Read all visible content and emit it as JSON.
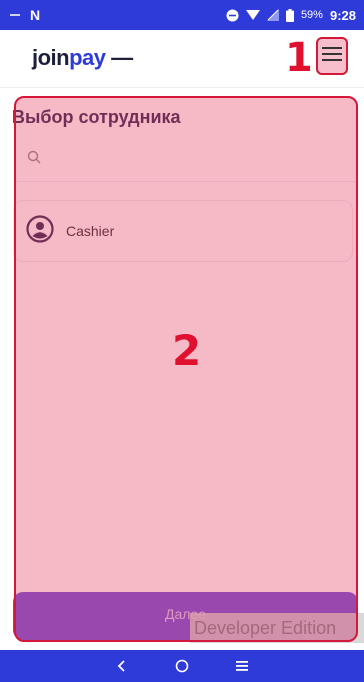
{
  "status_bar": {
    "left_letter": "N",
    "battery": "59%",
    "time": "9:28"
  },
  "header": {
    "logo_part1": "join",
    "logo_part2": "pay",
    "logo_part3": "—",
    "annotation_marker": "1"
  },
  "main": {
    "title": "Выбор сотрудника",
    "search_placeholder": "",
    "employees": [
      {
        "name": "Cashier"
      }
    ],
    "next_button_label": "Далее",
    "watermark": "Developer Edition",
    "annotation_marker": "2"
  },
  "colors": {
    "brand_blue": "#2f3bd9",
    "primary_button": "#6a4bd7",
    "annotation_red": "#d4183a"
  },
  "icons": {
    "menu": "hamburger-menu-icon",
    "search": "search-icon",
    "avatar": "user-avatar-icon",
    "back": "back-icon",
    "home": "home-icon",
    "recents": "recents-icon"
  }
}
